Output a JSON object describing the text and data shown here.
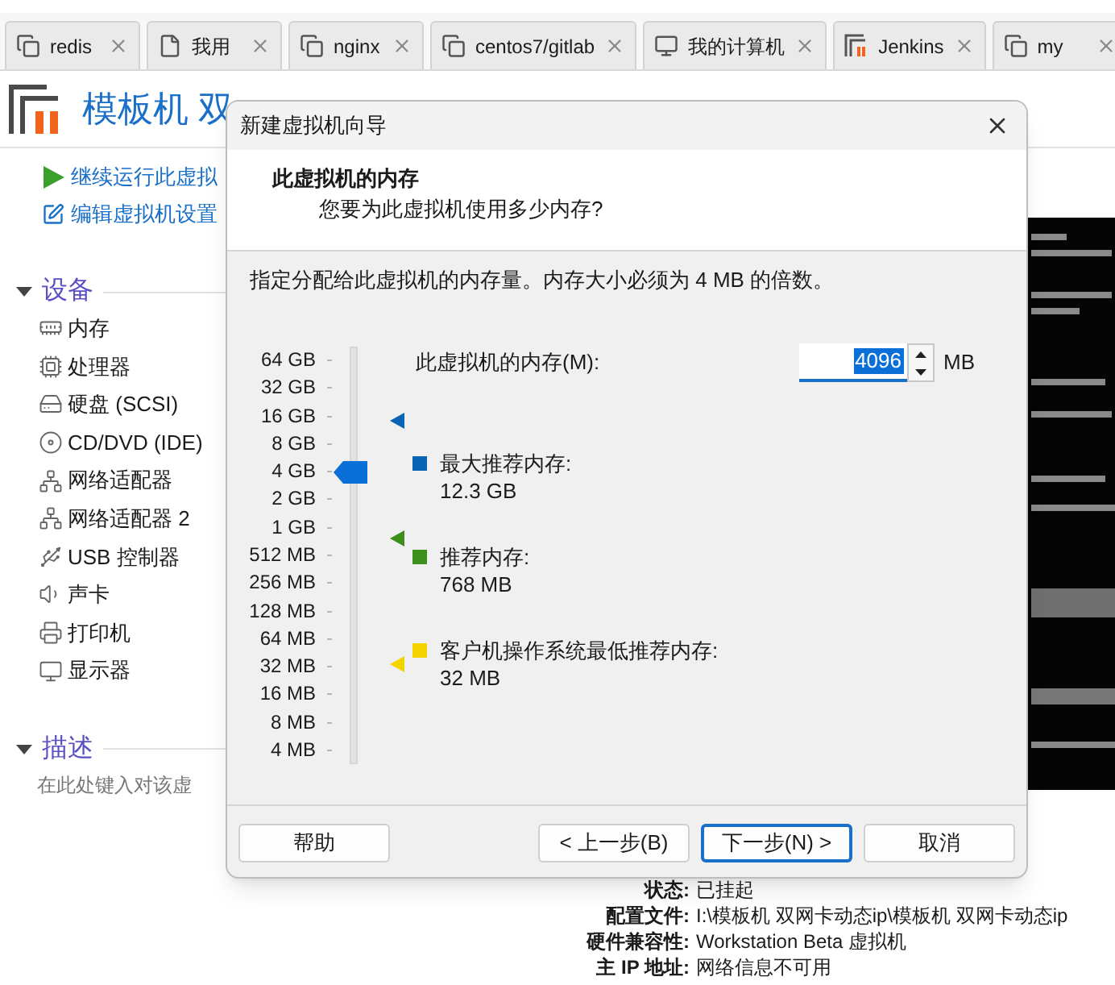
{
  "tabs": [
    {
      "label": "redis",
      "kind": "vm"
    },
    {
      "label": "我用",
      "kind": "document"
    },
    {
      "label": "nginx",
      "kind": "vm"
    },
    {
      "label": "centos7/gitlab",
      "kind": "vm"
    },
    {
      "label": "我的计算机",
      "kind": "computer"
    },
    {
      "label": "Jenkins",
      "kind": "running"
    },
    {
      "label": "my",
      "kind": "vm"
    }
  ],
  "vm_title": "模板机 双",
  "actions": [
    {
      "label": "继续运行此虚拟",
      "kind": "play"
    },
    {
      "label": "编辑虚拟机设置",
      "kind": "edit"
    }
  ],
  "devices": {
    "title": "设备",
    "expanded": true,
    "items": [
      {
        "label": "内存",
        "kind": "memory"
      },
      {
        "label": "处理器",
        "kind": "cpu"
      },
      {
        "label": "硬盘 (SCSI)",
        "kind": "disk"
      },
      {
        "label": "CD/DVD (IDE)",
        "kind": "cdrom"
      },
      {
        "label": "网络适配器",
        "kind": "network"
      },
      {
        "label": "网络适配器 2",
        "kind": "network"
      },
      {
        "label": "USB 控制器",
        "kind": "usb"
      },
      {
        "label": "声卡",
        "kind": "sound"
      },
      {
        "label": "打印机",
        "kind": "printer"
      },
      {
        "label": "显示器",
        "kind": "display"
      }
    ]
  },
  "description": {
    "title": "描述",
    "expanded": true,
    "placeholder": "在此处键入对该虚"
  },
  "details": [
    {
      "label": "状态:",
      "value": "已挂起"
    },
    {
      "label": "配置文件:",
      "value": "I:\\模板机 双网卡动态ip\\模板机 双网卡动态ip"
    },
    {
      "label": "硬件兼容性:",
      "value": "Workstation Beta 虚拟机"
    },
    {
      "label": "主 IP 地址:",
      "value": "网络信息不可用"
    }
  ],
  "dialog": {
    "title": "新建虚拟机向导",
    "heading": "此虚拟机的内存",
    "subheading": "您要为此虚拟机使用多少内存?",
    "instruction": "指定分配给此虚拟机的内存量。内存大小必须为 4 MB 的倍数。",
    "scale": [
      "64 GB",
      "32 GB",
      "16 GB",
      "8 GB",
      "4 GB",
      "2 GB",
      "1 GB",
      "512 MB",
      "256 MB",
      "128 MB",
      "64 MB",
      "32 MB",
      "16 MB",
      "8 MB",
      "4 MB"
    ],
    "memory": {
      "label": "此虚拟机的内存(M):",
      "value": "4096",
      "unit": "MB",
      "level": 0.714
    },
    "recommendations": [
      {
        "label": "最大推荐内存:",
        "value": "12.3 GB",
        "color": "#0b63b6",
        "level": 0.843
      },
      {
        "label": "推荐内存:",
        "value": "768 MB",
        "color": "#3d8f1b",
        "level": 0.545
      },
      {
        "label": "客户机操作系统最低推荐内存:",
        "value": "32 MB",
        "color": "#f5d400",
        "level": 0.223
      }
    ],
    "buttons": [
      {
        "label": "帮助",
        "default": false
      },
      {
        "label": "< 上一步(B)",
        "default": false
      },
      {
        "label": "下一步(N) >",
        "default": true
      },
      {
        "label": "取消",
        "default": false
      }
    ]
  }
}
